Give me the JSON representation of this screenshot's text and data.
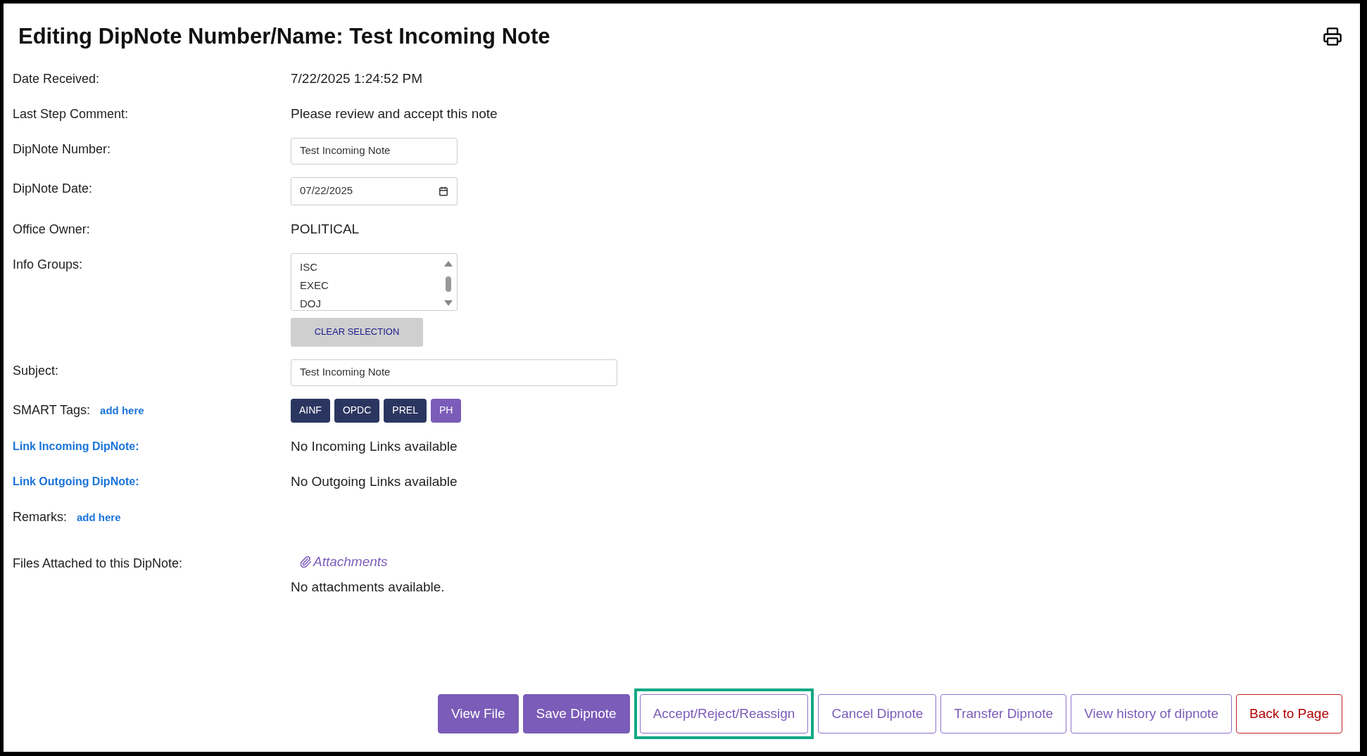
{
  "title": "Editing DipNote Number/Name: Test Incoming Note",
  "fields": [
    {
      "kind": "text",
      "label": "Date Received:",
      "value": "7/22/2025 1:24:52 PM"
    },
    {
      "kind": "text",
      "label": "Last Step Comment:",
      "value": "Please review and accept this note"
    },
    {
      "kind": "input",
      "label": "DipNote Number:",
      "value": "Test Incoming Note"
    },
    {
      "kind": "date",
      "label": "DipNote Date:",
      "value": "07/22/2025"
    },
    {
      "kind": "text",
      "label": "Office Owner:",
      "value": "POLITICAL"
    },
    {
      "kind": "listbox",
      "label": "Info Groups:",
      "options": [
        {
          "label": "ISC",
          "selected": false
        },
        {
          "label": "EXEC",
          "selected": false
        },
        {
          "label": "DOJ",
          "selected": false
        }
      ],
      "button": "CLEAR SELECTION"
    },
    {
      "kind": "wide_input",
      "label": "Subject:",
      "value": "Test Incoming Note"
    },
    {
      "kind": "tags",
      "label": "SMART Tags:",
      "link": "add here",
      "tags": [
        {
          "label": "AINF",
          "color": "#2b3660"
        },
        {
          "label": "OPDC",
          "color": "#2b3660"
        },
        {
          "label": "PREL",
          "color": "#2b3660"
        },
        {
          "label": "PH",
          "color": "#7b5cb8"
        }
      ]
    },
    {
      "kind": "link_label",
      "label": "Link Incoming DipNote:",
      "value": "No Incoming Links available"
    },
    {
      "kind": "link_label",
      "label": "Link Outgoing DipNote:",
      "value": "No Outgoing Links available"
    },
    {
      "kind": "remarks",
      "label": "Remarks:",
      "link": "add here"
    },
    {
      "kind": "files",
      "label": "Files Attached to this DipNote:",
      "link": "Attachments",
      "value": "No attachments available."
    }
  ],
  "buttons": [
    {
      "label": "View File",
      "kind": "primary",
      "highlighted": false
    },
    {
      "label": "Save Dipnote",
      "kind": "primary",
      "highlighted": false
    },
    {
      "label": "Accept/Reject/Reassign",
      "kind": "outline",
      "highlighted": true
    },
    {
      "label": "Cancel Dipnote",
      "kind": "outline",
      "highlighted": false
    },
    {
      "label": "Transfer Dipnote",
      "kind": "outline",
      "highlighted": false
    },
    {
      "label": "View history of dipnote",
      "kind": "outline",
      "highlighted": false
    },
    {
      "label": "Back to Page",
      "kind": "danger",
      "highlighted": false
    }
  ]
}
